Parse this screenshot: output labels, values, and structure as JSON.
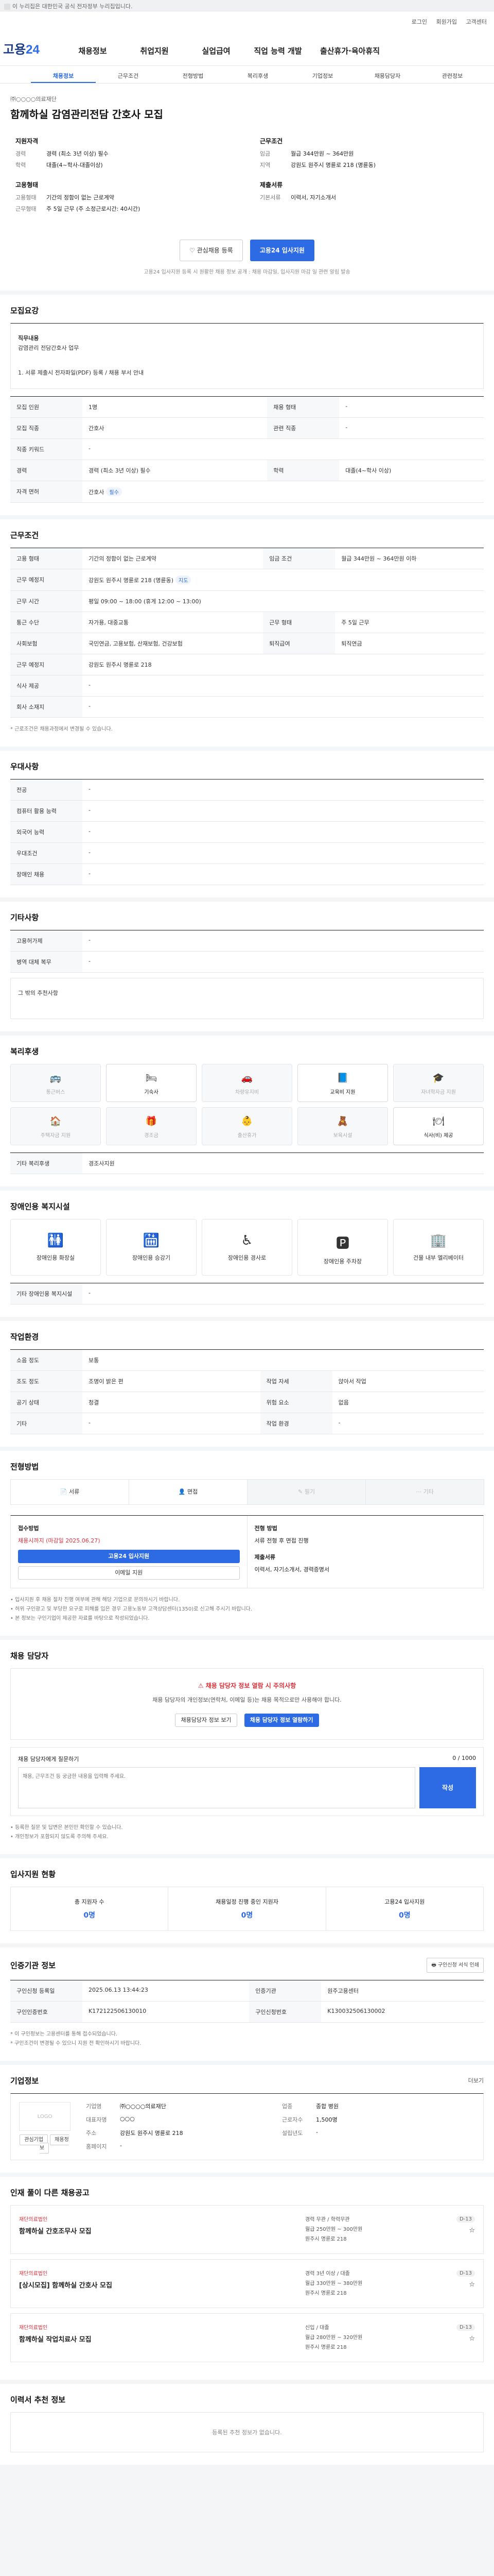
{
  "topbar": {
    "text": "이 누리집은 대한민국 공식 전자정부 누리집입니다."
  },
  "util": {
    "links": [
      "로그인",
      "회원가입",
      "고객센터"
    ]
  },
  "header": {
    "logo_a": "고용",
    "logo_b": "24",
    "menu": [
      "채용정보",
      "취업지원",
      "실업급여",
      "직업 능력 개발",
      "출산휴가·육아휴직"
    ]
  },
  "subnav": [
    "채용정보",
    "근무조건",
    "전형방법",
    "복리후생",
    "기업정보",
    "채용담당자",
    "관련정보"
  ],
  "job": {
    "company": "㈜○○○○의료재단",
    "title": "함께하실 감염관리전담 간호사 모집",
    "left_sections": [
      {
        "title": "지원자격",
        "rows": [
          {
            "k": "경력",
            "v": "경력 (최소 3년 이상) 필수"
          },
          {
            "k": "학력",
            "v": "대졸(4~학사-대졸이상)"
          }
        ]
      },
      {
        "title": "고용형태",
        "rows": [
          {
            "k": "고용형태",
            "v": "기간의 정함이 없는 근로계약"
          },
          {
            "k": "근무형태",
            "v": "주 5일 근무 (주 소정근로시간: 40시간)"
          }
        ]
      }
    ],
    "right_sections": [
      {
        "title": "근무조건",
        "rows": [
          {
            "k": "임금",
            "v": "월급 344만원 ~ 364만원"
          },
          {
            "k": "지역",
            "v": "강원도 원주시 명륜로 218 (명륜동)"
          }
        ]
      },
      {
        "title": "제출서류",
        "rows": [
          {
            "k": "기본서류",
            "v": "이력서, 자기소개서"
          },
          {
            "k": "",
            "v": ""
          }
        ]
      }
    ],
    "btn_save": "관심채용 등록",
    "btn_apply": "고용24 입사지원",
    "note": "고용24 입사지원 등록 시 원활한 채용 정보 공개 : 채용 마감일, 입사지원 마감 일 관련 알림 발송"
  },
  "recruit": {
    "title": "모집요강",
    "box_head": "직무내용",
    "box_body": "감염관리 전담간호사 업무",
    "box_line": "1. 서류 제출시 전자파일(PDF) 등록 / 채용 부서 안내",
    "rows": [
      {
        "k": "모집 인원",
        "v": "1명",
        "k2": "채용 형태",
        "v2": "-"
      },
      {
        "k": "모집 직종",
        "v": "간호사",
        "k2": "관련 직종",
        "v2": "-"
      },
      {
        "k": "직종 키워드",
        "v": "-",
        "k2": "",
        "v2": ""
      },
      {
        "k": "경력",
        "v": "경력 (최소 3년 이상) 필수",
        "k2": "학력",
        "v2": "대졸(4~학사 이상)"
      },
      {
        "k": "자격 면허",
        "v": "간호사",
        "k2": "",
        "v2": ""
      }
    ]
  },
  "conditions": {
    "title": "근무조건",
    "rows": [
      {
        "k": "고용 형태",
        "v": "기간의 정함이 없는 근로계약",
        "k2": "임금 조건",
        "v2": "월급 344만원 ~ 364만원 이하"
      },
      {
        "k": "근무 예정지",
        "v": "강원도 원주시 명륜로 218 (명륜동)",
        "k2": "",
        "v2": ""
      },
      {
        "k": "근무 시간",
        "v": "평일 09:00 ~ 18:00 (휴게 12:00 ~ 13:00)",
        "k2": "",
        "v2": ""
      },
      {
        "k": "통근 수단",
        "v": "자가용, 대중교통",
        "k2": "근무 형태",
        "v2": "주 5일 근무"
      },
      {
        "k": "사회보험",
        "v": "국민연금, 고용보험, 산재보험, 건강보험",
        "k2": "퇴직급여",
        "v2": "퇴직연금"
      },
      {
        "k": "근무 예정지",
        "v": "강원도 원주시 명륜로 218",
        "k2": "",
        "v2": ""
      },
      {
        "k": "식사 제공",
        "v": "-",
        "k2": "",
        "v2": ""
      },
      {
        "k": "회사 소재지",
        "v": "-",
        "k2": "",
        "v2": ""
      }
    ],
    "note": "* 근로조건은 채용과정에서 변경될 수 있습니다."
  },
  "preference": {
    "title": "우대사항",
    "rows": [
      {
        "k": "전공",
        "v": "-"
      },
      {
        "k": "컴퓨터 활용 능력",
        "v": "-"
      },
      {
        "k": "외국어 능력",
        "v": "-"
      },
      {
        "k": "우대조건",
        "v": "-"
      },
      {
        "k": "장애인 채용",
        "v": "-"
      }
    ]
  },
  "etc": {
    "title": "기타사항",
    "rows": [
      {
        "k": "고용허가제",
        "v": "-"
      },
      {
        "k": "병역 대체 복무",
        "v": "-"
      }
    ],
    "box": "그 밖의 추천사항"
  },
  "welfare": {
    "title": "복리후생",
    "items": [
      {
        "label": "통근버스",
        "on": false
      },
      {
        "label": "기숙사",
        "on": true
      },
      {
        "label": "차량유지비",
        "on": false
      },
      {
        "label": "교육비 지원",
        "on": true
      },
      {
        "label": "자녀학자금 지원",
        "on": false
      },
      {
        "label": "주택자금 지원",
        "on": false
      },
      {
        "label": "경조금",
        "on": false
      },
      {
        "label": "출산휴가",
        "on": false
      },
      {
        "label": "보육시설",
        "on": false
      },
      {
        "label": "식사(비) 제공",
        "on": true
      }
    ],
    "other_label": "기타 복리후생",
    "other_value": "경조사지원"
  },
  "disability": {
    "title": "장애인용 복지시설",
    "items": [
      "장애인용 화장실",
      "장애인용 승강기",
      "장애인용 경사로",
      "장애인용 주차장",
      "건물 내부 엘리베이터"
    ],
    "other_label": "기타 장애인용 복지시설",
    "other_value": "-"
  },
  "workplace": {
    "title": "작업환경",
    "rows": [
      {
        "k": "소음 정도",
        "v": "보통",
        "k2": "",
        "v2": ""
      },
      {
        "k": "조도 정도",
        "v": "조명이 밝은 편",
        "k2": "작업 자세",
        "v2": "앉아서 작업"
      },
      {
        "k": "공기 상태",
        "v": "청결",
        "k2": "위험 요소",
        "v2": "없음"
      },
      {
        "k": "기타",
        "v": "-",
        "k2": "작업 환경",
        "v2": "-"
      }
    ]
  },
  "process": {
    "title": "전형방법",
    "steps": [
      {
        "label": "서류",
        "on": true
      },
      {
        "label": "면접",
        "on": true
      },
      {
        "label": "필기",
        "on": false
      },
      {
        "label": "기타",
        "on": false
      }
    ],
    "apply_title": "접수방법",
    "apply_deadline": "채용시까지 (마감일 2025.06.27)",
    "apply_btn": "고용24 입사지원",
    "mail_btn": "이메일 지원",
    "method_title": "전형 방법",
    "method_body": "서류 전형 후 면접 진행",
    "docs_title": "제출서류",
    "docs_body": "이력서, 자기소개서, 경력증명서",
    "notes": [
      "• 입사지원 후 채용 절차 진행 여부에 관해 해당 기업으로 문의하시기 바랍니다.",
      "• 허위 구인광고 및 부당한 요구로 피해를 입은 경우 고용노동부 고객상담센터(1350)로 신고해 주시기 바랍니다.",
      "• 본 정보는 구인기업이 제공한 자료를 바탕으로 작성되었습니다."
    ]
  },
  "contact": {
    "title": "채용 담당자",
    "notice_title": "채용 담당자 정보 열람 시 주의사항",
    "notice_body": "채용 담당자의 개인정보(연락처, 이메일 등)는 채용 목적으로만 사용해야 합니다.",
    "btn_view": "채용담당자 정보 보기",
    "btn_agree": "채용 담당자 정보 열람하기",
    "inquiry_title": "채용 담당자에게 질문하기",
    "inquiry_count": "0 / 1000",
    "inquiry_placeholder": "채용, 근무조건 등 궁금한 내용을 입력해 주세요.",
    "inquiry_send": "작성",
    "inquiry_notes": [
      "• 등록한 질문 및 답변은 본인만 확인할 수 있습니다.",
      "• 개인정보가 포함되지 않도록 주의해 주세요."
    ]
  },
  "stats": {
    "title": "입사지원 현황",
    "items": [
      {
        "label": "총 지원자 수",
        "value": "0명"
      },
      {
        "label": "채용일정 진행 중인 지원자",
        "value": "0명"
      },
      {
        "label": "고용24 입사지원",
        "value": "0명"
      }
    ]
  },
  "reginfo": {
    "title": "인증기관 정보",
    "btn": "구인신청 서식 인쇄",
    "rows": [
      {
        "k": "구인신청 등록일",
        "v": "2025.06.13 13:44:23",
        "k2": "인증기관",
        "v2": "원주고용센터"
      },
      {
        "k": "구인인증번호",
        "v": "K172122506130010",
        "k2": "구인신청번호",
        "v2": "K130032506130002"
      }
    ],
    "notes": [
      "* 이 구인정보는 고용센터를 통해 접수되었습니다.",
      "* 구인조건이 변경될 수 있으니 지원 전 확인하시기 바랍니다."
    ]
  },
  "company": {
    "title": "기업정보",
    "more": "더보기",
    "logo_alt": "LOGO",
    "btn_fav": "관심기업",
    "btn_jobs": "채용정보",
    "rows": [
      {
        "k": "기업명",
        "v": "㈜○○○○의료재단",
        "k2": "업종",
        "v2": "종합 병원"
      },
      {
        "k": "대표자명",
        "v": "○○○",
        "k2": "근로자수",
        "v2": "1,500명"
      },
      {
        "k": "주소",
        "v": "강원도 원주시 명륜로 218",
        "k2": "설립년도",
        "v2": "-"
      },
      {
        "k": "홈페이지",
        "v": "-",
        "k2": "",
        "v2": ""
      }
    ]
  },
  "other_jobs": {
    "title": "인재 풀이 다른 채용공고",
    "items": [
      {
        "co": "재단의료법인",
        "title": "함께하실 간호조무사 모집",
        "l1": "경력 무관 / 학력무관",
        "l2": "월급 250만원 ~ 300만원",
        "l3": "원주시 명륜로 218",
        "d": "D-13"
      },
      {
        "co": "재단의료법인",
        "title": "[상시모집] 함께하실 간호사 모집",
        "l1": "경력 3년 이상 / 대졸",
        "l2": "월급 330만원 ~ 380만원",
        "l3": "원주시 명륜로 218",
        "d": "D-13"
      },
      {
        "co": "재단의료법인",
        "title": "함께하실 작업치료사 모집",
        "l1": "신입 / 대졸",
        "l2": "월급 280만원 ~ 320만원",
        "l3": "원주시 명륜로 218",
        "d": "D-13"
      }
    ]
  },
  "recommend": {
    "title": "이력서 추천 정보",
    "empty": "등록된 추천 정보가 없습니다."
  },
  "colors": {
    "primary": "#2d6be4",
    "alert": "#e0303a"
  }
}
